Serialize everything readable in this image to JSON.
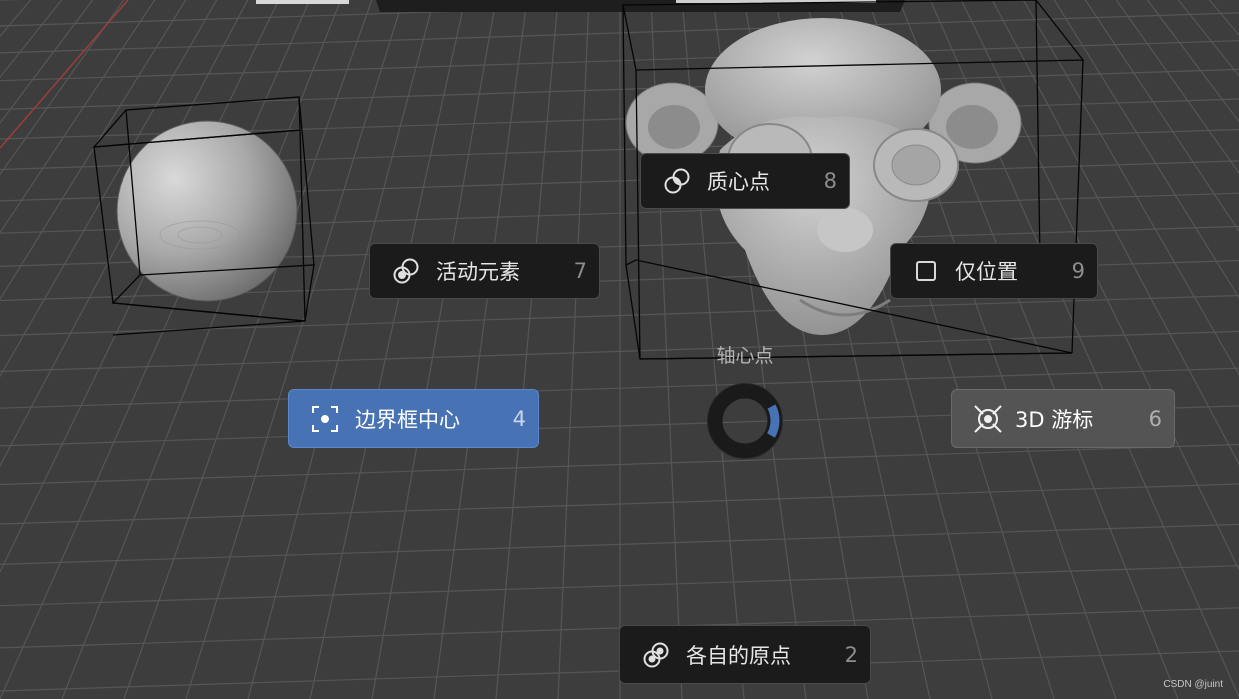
{
  "pie_menu": {
    "title": "轴心点",
    "items": [
      {
        "label": "质心点",
        "shortcut": "8",
        "icon": "median-point-icon",
        "state": "normal"
      },
      {
        "label": "活动元素",
        "shortcut": "7",
        "icon": "active-element-icon",
        "state": "normal"
      },
      {
        "label": "仅位置",
        "shortcut": "9",
        "icon": "checkbox-icon",
        "state": "normal"
      },
      {
        "label": "边界框中心",
        "shortcut": "4",
        "icon": "bounding-box-center-icon",
        "state": "selected"
      },
      {
        "label": "3D 游标",
        "shortcut": "6",
        "icon": "3d-cursor-icon",
        "state": "hover"
      },
      {
        "label": "各自的原点",
        "shortcut": "2",
        "icon": "individual-origins-icon",
        "state": "normal"
      }
    ]
  },
  "scene": {
    "objects": [
      "sphere",
      "monkey"
    ],
    "grid_color": "#565656",
    "background_color": "#3d3d3d"
  },
  "colors": {
    "accent": "#4772b3",
    "item_bg": "#1b1b1b",
    "hover_bg": "#545454"
  },
  "watermark": "CSDN @juint"
}
